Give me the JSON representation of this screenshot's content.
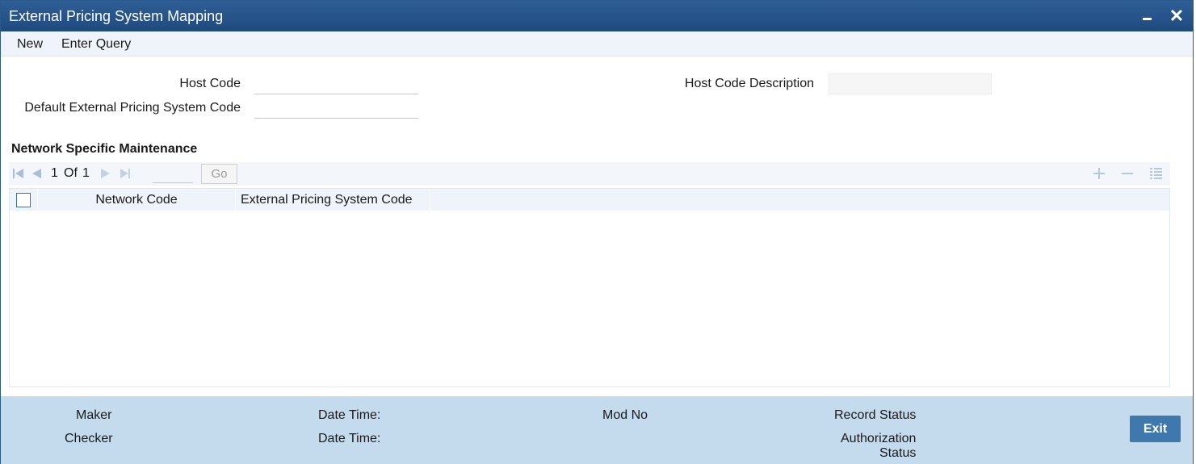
{
  "window": {
    "title": "External Pricing System Mapping",
    "minimize_icon": "minimize-icon",
    "close_icon": "close-icon"
  },
  "menu": {
    "new_label": "New",
    "enter_query_label": "Enter Query"
  },
  "form": {
    "host_code_label": "Host Code",
    "host_code_value": "",
    "host_code_description_label": "Host Code Description",
    "host_code_description_value": "",
    "default_ext_pricing_label": "Default External Pricing System Code",
    "default_ext_pricing_value": ""
  },
  "network_section": {
    "title": "Network Specific Maintenance",
    "pagination": {
      "current_page": "1",
      "of_label": "Of",
      "total_pages": "1",
      "go_label": "Go",
      "page_input_value": ""
    },
    "columns": [
      "Network Code",
      "External Pricing System Code"
    ],
    "rows": []
  },
  "footer": {
    "maker_label": "Maker",
    "checker_label": "Checker",
    "maker_datetime_label": "Date Time:",
    "checker_datetime_label": "Date Time:",
    "mod_no_label": "Mod No",
    "record_status_label": "Record Status",
    "authorization_label": "Authorization",
    "status_label": "Status",
    "exit_label": "Exit"
  },
  "colors": {
    "title_bar": "#1f4a7e",
    "footer_bg": "#c4dbee",
    "exit_button": "#3f78ad"
  }
}
